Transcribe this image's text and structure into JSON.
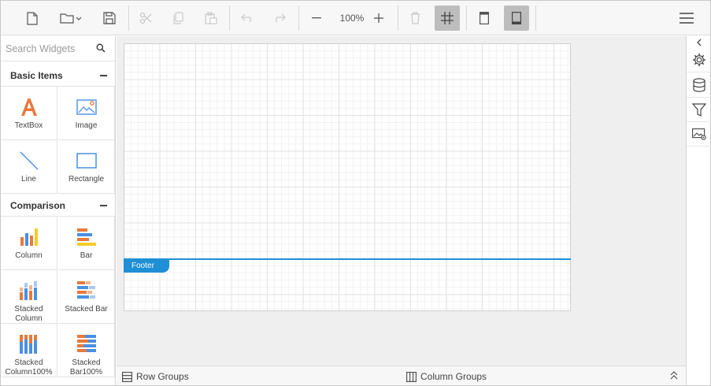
{
  "toolbar": {
    "buttons": [
      "new-file",
      "open-folder",
      "save",
      "cut",
      "copy",
      "paste",
      "undo",
      "redo",
      "zoom-out",
      "zoom-in",
      "delete",
      "grid-toggle",
      "header-toggle",
      "footer-toggle",
      "menu"
    ],
    "zoom_level": "100%",
    "active_buttons": [
      "grid-toggle",
      "footer-toggle"
    ]
  },
  "left_panel": {
    "search": {
      "placeholder": "Search Widgets",
      "value": ""
    },
    "groups": [
      {
        "title": "Basic Items",
        "items": [
          {
            "label": "TextBox",
            "icon": "textbox-icon"
          },
          {
            "label": "Image",
            "icon": "image-icon"
          },
          {
            "label": "Line",
            "icon": "line-icon"
          },
          {
            "label": "Rectangle",
            "icon": "rectangle-icon"
          }
        ]
      },
      {
        "title": "Comparison",
        "items": [
          {
            "label": "Column",
            "icon": "column-chart-icon"
          },
          {
            "label": "Bar",
            "icon": "bar-chart-icon"
          },
          {
            "label": "Stacked\nColumn",
            "icon": "stacked-column-icon"
          },
          {
            "label": "Stacked Bar",
            "icon": "stacked-bar-icon"
          },
          {
            "label": "Stacked\nColumn100%",
            "icon": "stacked-column-100-icon"
          },
          {
            "label": "Stacked\nBar100%",
            "icon": "stacked-bar-100-icon"
          }
        ]
      }
    ]
  },
  "design": {
    "footer_label": "Footer"
  },
  "grouping_bar": {
    "row_groups": "Row Groups",
    "column_groups": "Column Groups"
  },
  "right_panel": {
    "buttons": [
      "collapse-panel",
      "properties",
      "data-sources",
      "filters",
      "image-manager"
    ]
  },
  "colors": {
    "accent": "#1f8fd6",
    "orange": "#e8793c",
    "blue": "#4a90e2",
    "yellow": "#f5cc2a",
    "toolbar_bg": "#f7f7f7",
    "canvas_bg": "#efefef"
  }
}
